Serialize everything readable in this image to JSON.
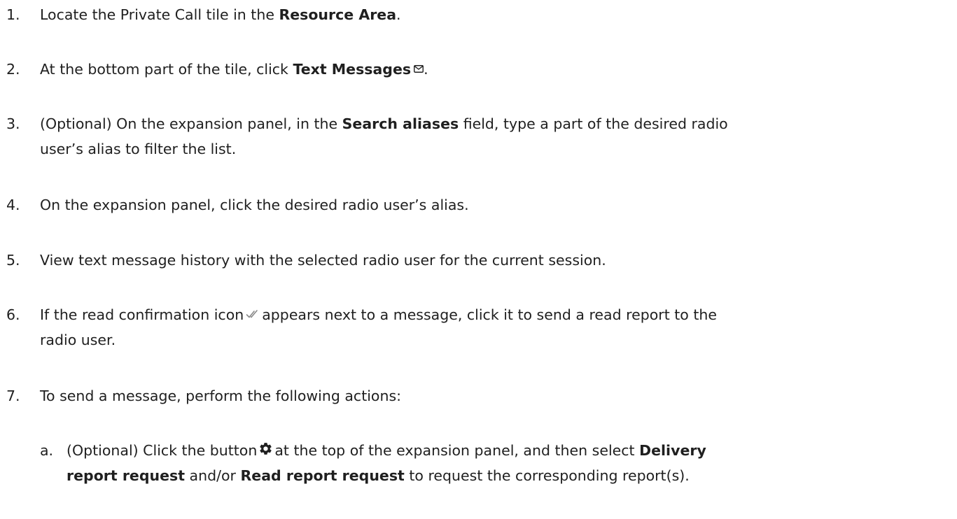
{
  "steps": [
    {
      "number": "1.",
      "text_a": "Locate the Private Call tile in the ",
      "bold_a": "Resource Area",
      "text_b": "."
    },
    {
      "number": "2.",
      "text_a": "At the bottom part of the tile, click ",
      "bold_a": "Text Messages",
      "icon": "mail-icon",
      "text_b": "."
    },
    {
      "number": "3.",
      "text_a": "(Optional) On the expansion panel, in the ",
      "bold_a": "Search aliases",
      "text_b": " field, type a part of the desired radio",
      "line2": "user’s alias to filter the list."
    },
    {
      "number": "4.",
      "text_a": "On the expansion panel, click the desired radio user’s alias."
    },
    {
      "number": "5.",
      "text_a": "View text message history with the selected radio user for the current session."
    },
    {
      "number": "6.",
      "text_a": "If the read confirmation icon",
      "icon": "double-check-icon",
      "text_b": "appears next to a message, click it to send a read report to the",
      "line2": "radio user."
    },
    {
      "number": "7.",
      "text_a": "To send a message, perform the following actions:"
    }
  ],
  "substeps": [
    {
      "letter": "a.",
      "text_a": "(Optional) Click the button",
      "icon": "gear-icon",
      "text_b": "at the top of the expansion panel, and then select ",
      "bold_a": "Delivery",
      "bold_b": "report request",
      "text_c": " and/or ",
      "bold_c": "Read report request",
      "text_d": " to request the corresponding report(s)."
    }
  ]
}
